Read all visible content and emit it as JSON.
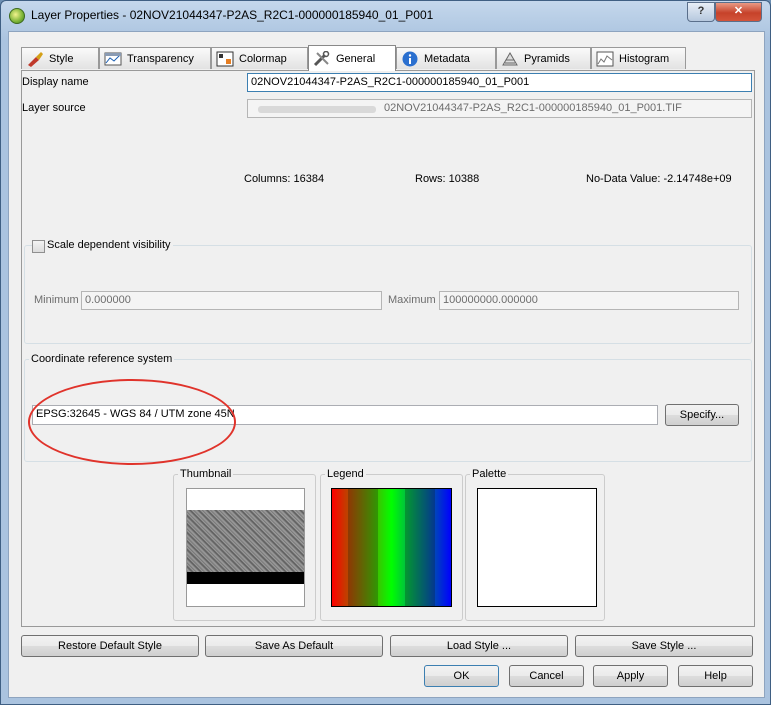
{
  "window": {
    "title": "Layer Properties - 02NOV21044347-P2AS_R2C1-000000185940_01_P001",
    "help_label": "?",
    "close_label": "✕"
  },
  "tabs": [
    {
      "label": "Style",
      "icon": "paintbrush-icon"
    },
    {
      "label": "Transparency",
      "icon": "transparency-icon"
    },
    {
      "label": "Colormap",
      "icon": "colormap-icon"
    },
    {
      "label": "General",
      "icon": "tools-icon",
      "active": true
    },
    {
      "label": "Metadata",
      "icon": "info-icon"
    },
    {
      "label": "Pyramids",
      "icon": "pyramid-icon"
    },
    {
      "label": "Histogram",
      "icon": "histogram-icon"
    }
  ],
  "general": {
    "display_name_label": "Display name",
    "display_name_value": "02NOV21044347-P2AS_R2C1-000000185940_01_P001",
    "layer_source_label": "Layer source",
    "layer_source_value": "02NOV21044347-P2AS_R2C1-000000185940_01_P001.TIF",
    "columns": "Columns: 16384",
    "rows": "Rows: 10388",
    "nodata": "No-Data Value: -2.14748e+09"
  },
  "scale": {
    "checkbox_label": "Scale dependent visibility",
    "checked": false,
    "minimum_label": "Minimum",
    "minimum_value": "0.000000",
    "maximum_label": "Maximum",
    "maximum_value": "100000000.000000"
  },
  "crs": {
    "group_title": "Coordinate reference system",
    "value": "EPSG:32645 - WGS 84 / UTM zone 45N",
    "specify_label": "Specify..."
  },
  "previews": {
    "thumbnail_title": "Thumbnail",
    "legend_title": "Legend",
    "palette_title": "Palette"
  },
  "style_buttons": {
    "restore": "Restore Default Style",
    "save_default": "Save As Default",
    "load": "Load Style ...",
    "save": "Save Style ..."
  },
  "dialog_buttons": {
    "ok": "OK",
    "cancel": "Cancel",
    "apply": "Apply",
    "help": "Help"
  },
  "colors": {
    "annotation": "#e0332b",
    "legend_red": "#ff0000",
    "legend_green": "#00ff00",
    "legend_blue": "#0000ff"
  }
}
